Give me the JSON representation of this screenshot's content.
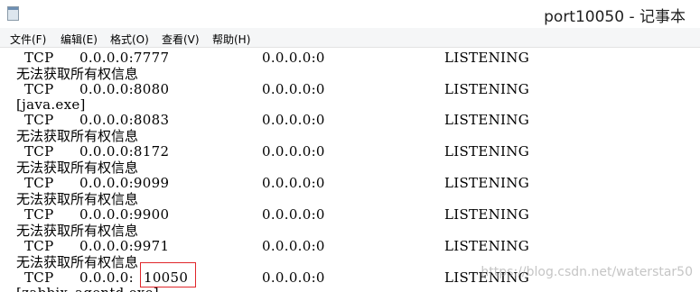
{
  "window": {
    "title": "port10050 - 记事本"
  },
  "menu": [
    {
      "label": "文件(F)"
    },
    {
      "label": "编辑(E)"
    },
    {
      "label": "格式(O)"
    },
    {
      "label": "查看(V)"
    },
    {
      "label": "帮助(H)"
    }
  ],
  "lines": [
    {
      "kind": "row",
      "proto": "TCP",
      "local": "0.0.0.0:7777",
      "remote": "0.0.0.0:0",
      "state": "LISTENING"
    },
    {
      "kind": "note",
      "text": "无法获取所有权信息"
    },
    {
      "kind": "row",
      "proto": "TCP",
      "local": "0.0.0.0:8080",
      "remote": "0.0.0.0:0",
      "state": "LISTENING"
    },
    {
      "kind": "note",
      "text": "[java.exe]"
    },
    {
      "kind": "row",
      "proto": "TCP",
      "local": "0.0.0.0:8083",
      "remote": "0.0.0.0:0",
      "state": "LISTENING"
    },
    {
      "kind": "note",
      "text": "无法获取所有权信息"
    },
    {
      "kind": "row",
      "proto": "TCP",
      "local": "0.0.0.0:8172",
      "remote": "0.0.0.0:0",
      "state": "LISTENING"
    },
    {
      "kind": "note",
      "text": "无法获取所有权信息"
    },
    {
      "kind": "row",
      "proto": "TCP",
      "local": "0.0.0.0:9099",
      "remote": "0.0.0.0:0",
      "state": "LISTENING"
    },
    {
      "kind": "note",
      "text": "无法获取所有权信息"
    },
    {
      "kind": "row",
      "proto": "TCP",
      "local": "0.0.0.0:9900",
      "remote": "0.0.0.0:0",
      "state": "LISTENING"
    },
    {
      "kind": "note",
      "text": "无法获取所有权信息"
    },
    {
      "kind": "row",
      "proto": "TCP",
      "local": "0.0.0.0:9971",
      "remote": "0.0.0.0:0",
      "state": "LISTENING"
    },
    {
      "kind": "note",
      "text": "无法获取所有权信息"
    },
    {
      "kind": "row",
      "proto": "TCP",
      "local_prefix": "0.0.0.0:",
      "local_port": "10050",
      "remote": "0.0.0.0:0",
      "state": "LISTENING"
    },
    {
      "kind": "note",
      "text": "[zabbix_agentd.exe]"
    }
  ],
  "watermark": "https://blog.csdn.net/waterstar50",
  "colors": {
    "highlight_border": "#e0262a",
    "menubar_bg": "#f5f6f7"
  }
}
